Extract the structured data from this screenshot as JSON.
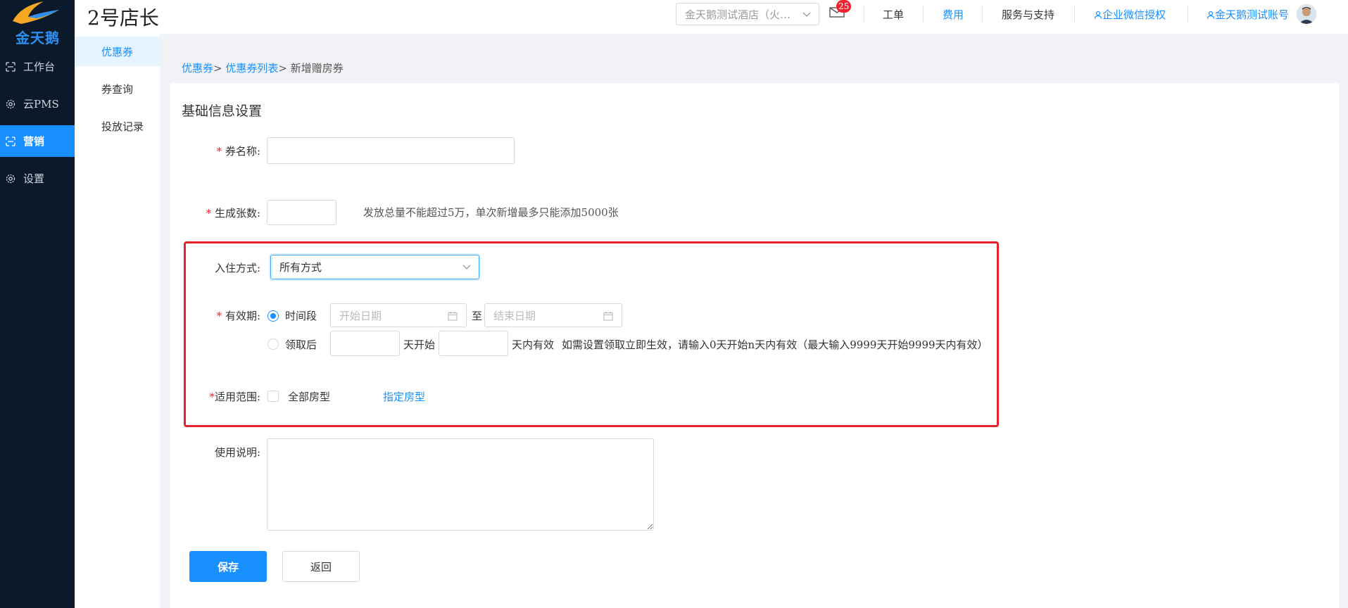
{
  "sidebar": {
    "logo_text": "金天鹅",
    "items": [
      {
        "label": "工作台",
        "icon": "workbench-icon"
      },
      {
        "label": "云PMS",
        "icon": "gear-icon"
      },
      {
        "label": "营销",
        "icon": "marketing-icon"
      },
      {
        "label": "设置",
        "icon": "gear-icon"
      }
    ]
  },
  "submenu": {
    "items": [
      {
        "label": "优惠券"
      },
      {
        "label": "券查询"
      },
      {
        "label": "投放记录"
      }
    ]
  },
  "header": {
    "brand": "2号店长",
    "hotel_select": "金天鹅测试酒店（火…",
    "mail_badge": "25",
    "links": {
      "work_order": "工单",
      "fees": "费用",
      "service": "服务与支持",
      "wechat": "企业微信授权",
      "account": "金天鹅测试账号"
    }
  },
  "breadcrumb": {
    "level1": "优惠券",
    "sep1": "> ",
    "level2": "优惠券列表",
    "sep2": "> ",
    "current": "新增赠房券"
  },
  "form": {
    "section_title": "基础信息设置",
    "name_label": "券名称:",
    "count_label": "生成张数:",
    "count_hint": "发放总量不能超过5万，单次新增最多只能添加5000张",
    "checkin_label": "入住方式:",
    "checkin_value": "所有方式",
    "validity_label": "有效期:",
    "option_period": "时间段",
    "start_placeholder": "开始日期",
    "to": "至",
    "end_placeholder": "结束日期",
    "option_after": "领取后",
    "days_start": "天开始",
    "days_valid": "天内有效",
    "after_hint": "如需设置领取立即生效，请输入0天开始n天内有效（最大输入9999天开始9999天内有效）",
    "scope_label": "适用范围:",
    "all_rooms": "全部房型",
    "specify_rooms": "指定房型",
    "desc_label": "使用说明:",
    "save": "保存",
    "back": "返回"
  },
  "colors": {
    "accent": "#1890ff",
    "sidebar_bg": "#0b1a2b",
    "highlight_box": "#e8212e",
    "required": "#f5222d"
  }
}
